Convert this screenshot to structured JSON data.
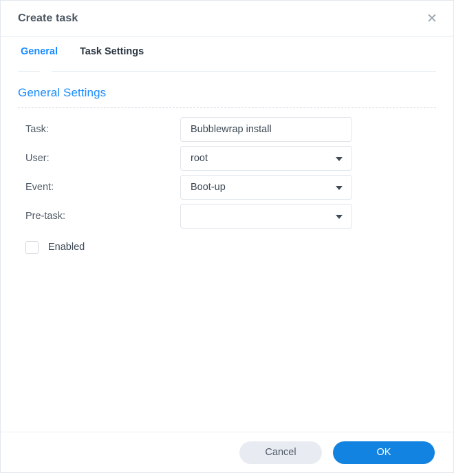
{
  "dialog": {
    "title": "Create task",
    "close_icon": "close-icon",
    "close_glyph": "✕"
  },
  "tabs": [
    {
      "label": "General",
      "active": true
    },
    {
      "label": "Task Settings",
      "active": false
    }
  ],
  "section": {
    "title": "General Settings"
  },
  "form": {
    "rows": [
      {
        "label": "Task:",
        "type": "text",
        "value": "Bubblewrap install",
        "placeholder": "",
        "name": "task"
      },
      {
        "label": "User:",
        "type": "select",
        "value": "root",
        "name": "user"
      },
      {
        "label": "Event:",
        "type": "select",
        "value": "Boot-up",
        "name": "event"
      },
      {
        "label": "Pre-task:",
        "type": "select",
        "value": "",
        "name": "pre-task"
      }
    ],
    "checkbox": {
      "label": "Enabled",
      "checked": false
    }
  },
  "footer": {
    "cancel_label": "Cancel",
    "ok_label": "OK"
  },
  "colors": {
    "accent": "#1a8cff",
    "primary_button": "#1283e0",
    "cancel_button": "#e8ecf2",
    "text": "#3d4853",
    "border": "#dfe5ec"
  }
}
